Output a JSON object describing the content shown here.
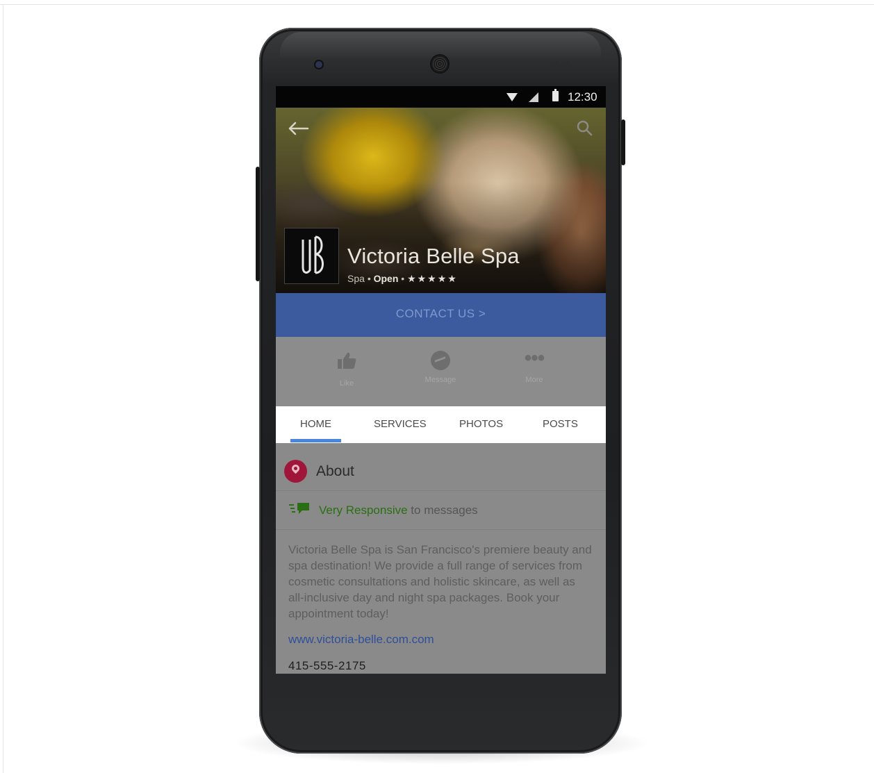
{
  "status_bar": {
    "time": "12:30"
  },
  "page": {
    "name": "Victoria Belle Spa",
    "category": "Spa",
    "status": "Open",
    "stars": "★★★★★",
    "rating": 5
  },
  "contact_button": {
    "label": "CONTACT US >"
  },
  "actions": [
    {
      "label": "Like",
      "icon": "thumbs-up-icon"
    },
    {
      "label": "Message",
      "icon": "messenger-icon"
    },
    {
      "label": "More",
      "icon": "more-dots-icon"
    }
  ],
  "tabs": [
    {
      "label": "HOME",
      "active": true
    },
    {
      "label": "SERVICES",
      "active": false
    },
    {
      "label": "PHOTOS",
      "active": false
    },
    {
      "label": "POSTS",
      "active": false
    }
  ],
  "about": {
    "title": "About",
    "responsive_strong": "Very Responsive",
    "responsive_rest": " to messages",
    "description": "Victoria Belle Spa is San Francisco's premiere beauty and spa destination! We provide a full range of services from cosmetic consultations and holistic skincare, as well as all-inclusive day and night spa packages. Book your appointment today!",
    "website": "www.victoria-belle.com.com",
    "phone": "415-555-2175"
  },
  "colors": {
    "contact_bar": "#3c5a9e",
    "tab_indicator": "#4a86e0",
    "responsive_green": "#2a6f13",
    "about_pin": "#a0153a"
  }
}
